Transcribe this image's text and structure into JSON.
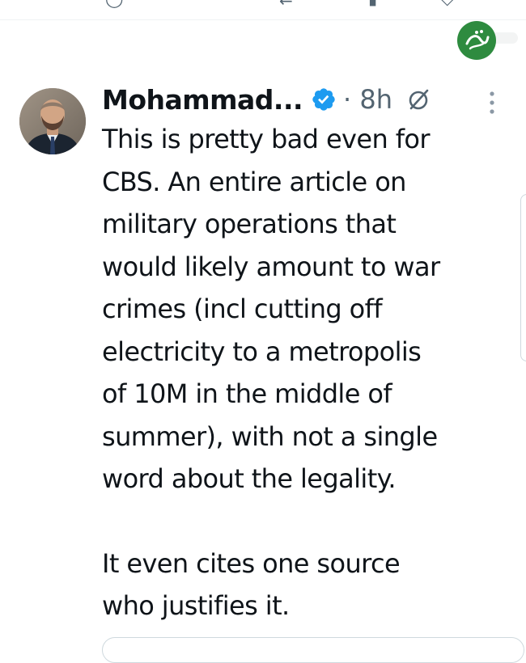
{
  "tweet": {
    "author_name": "Mohammad...",
    "time": "· 8h",
    "lines_p1": [
      "This is pretty bad even for",
      "CBS. An entire article on",
      "military operations that",
      "would likely amount to war",
      "crimes (incl cutting off",
      "electricity to a metropolis",
      "of 10M in the middle of",
      "summer), with not a single",
      "word about the legality."
    ],
    "lines_p2": [
      "It even cites one source",
      "who justifies it."
    ]
  },
  "icons": {
    "verified": "verified-badge-icon",
    "grok": "grok-icon",
    "more": "more-options-icon",
    "watermark": "channel-logo"
  },
  "colors": {
    "text": "#0f1419",
    "muted": "#536471",
    "verified_blue": "#1d9bf0",
    "watermark_green": "#2e8b3f"
  }
}
